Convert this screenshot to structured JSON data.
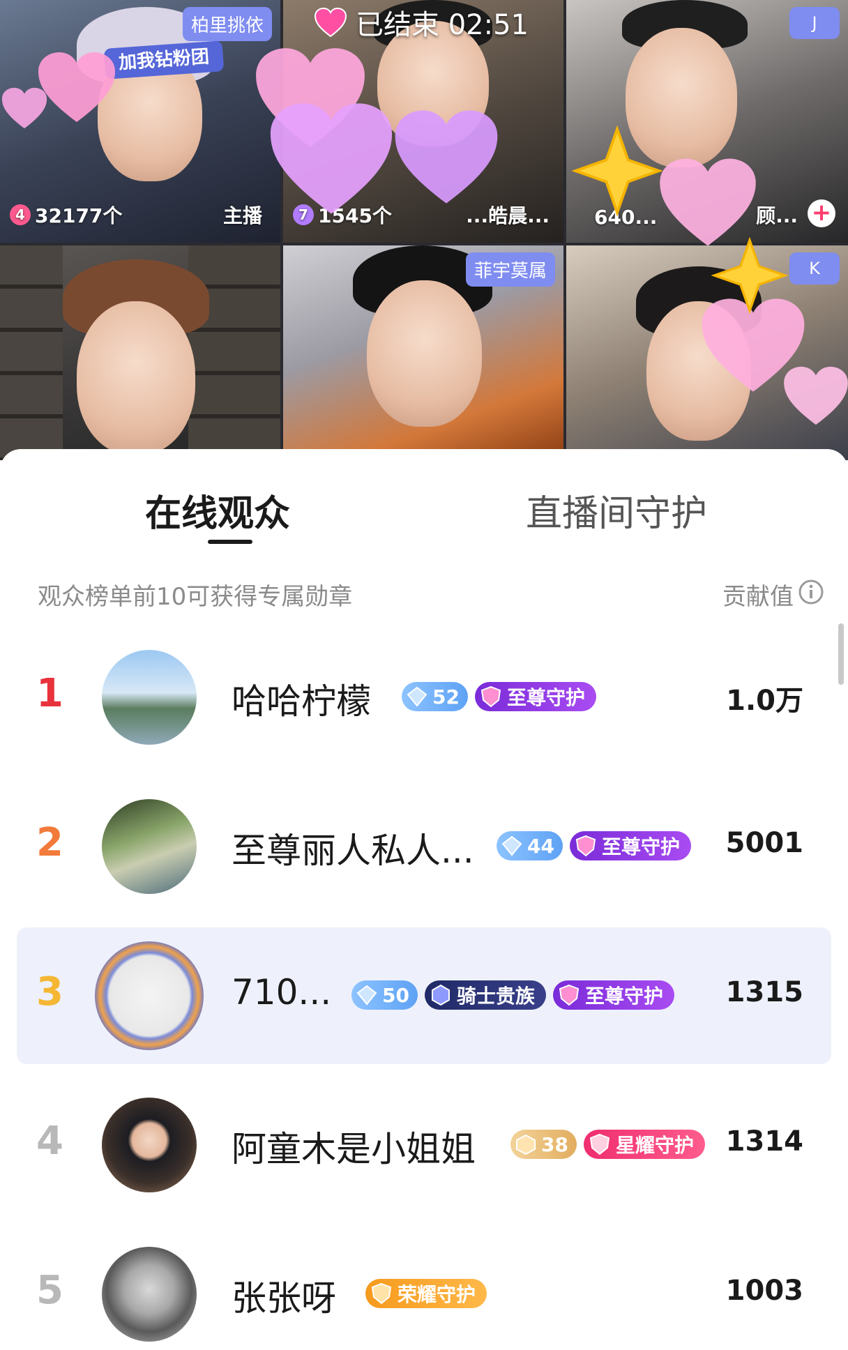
{
  "stream": {
    "status_text": "已结束 02:51",
    "tiles": [
      {
        "name_tag": "柏里挑依",
        "count_badge": "4",
        "count_text": "32177个",
        "role": "主播",
        "sign_text": "加我钻粉团"
      },
      {
        "count_badge": "7",
        "count_text": "1545个",
        "role": "...皓晨..."
      },
      {
        "letter": "J",
        "count_text": "640...",
        "role": "顾..."
      },
      {},
      {
        "name_tag": "菲宇莫属"
      },
      {
        "letter": "K"
      }
    ]
  },
  "tabs": {
    "active": "在线观众",
    "inactive": "直播间守护"
  },
  "list_header": {
    "hint": "观众榜单前10可获得专属勋章",
    "contribution_label": "贡献值"
  },
  "viewers": [
    {
      "rank": "1",
      "name": "哈哈柠檬",
      "level": "52",
      "guard": "至尊守护",
      "score": "1.0万"
    },
    {
      "rank": "2",
      "name": "至尊丽人私人...",
      "level": "44",
      "guard": "至尊守护",
      "score": "5001"
    },
    {
      "rank": "3",
      "name": "710...",
      "level": "50",
      "noble": "骑士贵族",
      "guard": "至尊守护",
      "score": "1315"
    },
    {
      "rank": "4",
      "name": "阿童木是小姐姐",
      "level": "38",
      "guard": "星耀守护",
      "score": "1314"
    },
    {
      "rank": "5",
      "name": "张张呀",
      "guard": "荣耀守护",
      "score": "1003"
    }
  ],
  "colors": {
    "rank1": "#e8323c",
    "rank2": "#f27a3a",
    "rank3": "#f5b633",
    "rank_other": "#b8b8b8",
    "highlight_row": "#eef1fb",
    "tag_blue": "#7f8cf0"
  }
}
